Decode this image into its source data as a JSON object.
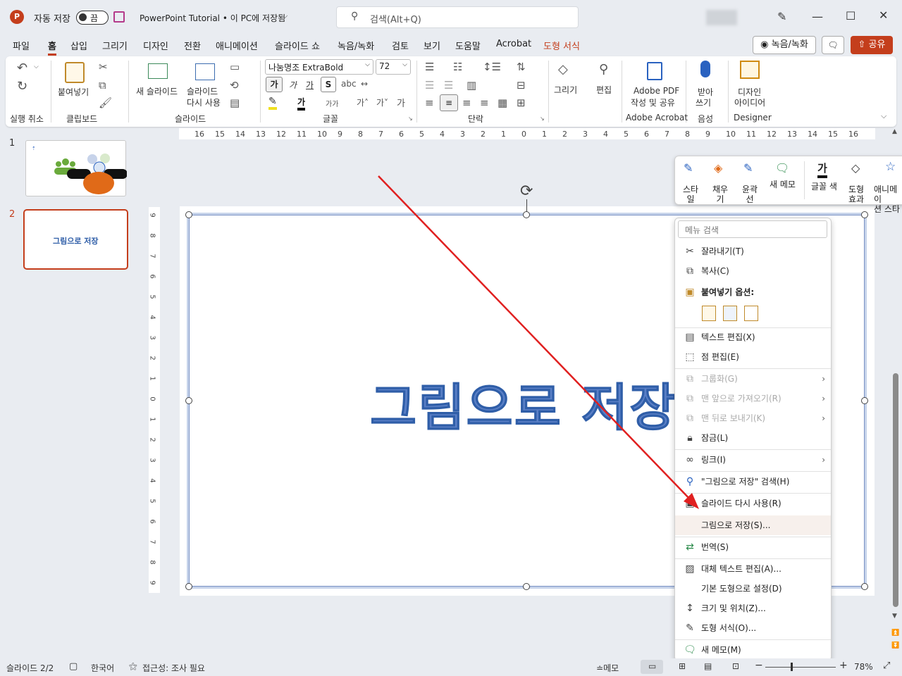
{
  "titlebar": {
    "autosave_label": "자동 저장",
    "autosave_state": "끔",
    "doc_title": "PowerPoint Tutorial • 이 PC에 저장됨",
    "search_placeholder": "검색(Alt+Q)"
  },
  "tabs": [
    "파일",
    "홈",
    "삽입",
    "그리기",
    "디자인",
    "전환",
    "애니메이션",
    "슬라이드 쇼",
    "녹음/녹화",
    "검토",
    "보기",
    "도움말",
    "Acrobat",
    "도형 서식"
  ],
  "active_tab": "홈",
  "record_button": "녹음/녹화",
  "share_button": "공유",
  "ribbon": {
    "groups": [
      "실행 취소",
      "클립보드",
      "슬라이드",
      "글꼴",
      "단락",
      "Adobe Acrobat",
      "음성",
      "Designer"
    ],
    "paste_label": "붙여넣기",
    "new_slide_label": "새 슬라이드",
    "reuse_slide_label_1": "슬라이드",
    "reuse_slide_label_2": "다시 사용",
    "font_name": "나눔명조 ExtraBold",
    "font_size": "72",
    "bold_glyph": "가",
    "drawing_label": "그리기",
    "editing_label": "편집",
    "adobe_label_1": "Adobe PDF",
    "adobe_label_2": "작성 및 공유",
    "dictate_label_1": "받아",
    "dictate_label_2": "쓰기",
    "designer_label_1": "디자인",
    "designer_label_2": "아이디어"
  },
  "ruler_h": [
    "16",
    "15",
    "14",
    "13",
    "12",
    "11",
    "10",
    "9",
    "8",
    "7",
    "6",
    "5",
    "4",
    "3",
    "2",
    "1",
    "0",
    "1",
    "2",
    "3",
    "4",
    "5",
    "6",
    "7",
    "8",
    "9",
    "10",
    "11",
    "12",
    "13",
    "14",
    "15",
    "16"
  ],
  "ruler_v": [
    "9",
    "8",
    "7",
    "6",
    "5",
    "4",
    "3",
    "2",
    "1",
    "0",
    "1",
    "2",
    "3",
    "4",
    "5",
    "6",
    "7",
    "8",
    "9"
  ],
  "slides": [
    {
      "number": "1"
    },
    {
      "number": "2",
      "title": "그림으로 저장"
    }
  ],
  "slide_text": "그림으로 저장",
  "mini_toolbar": {
    "style_1": "스타",
    "style_2": "일",
    "fill_1": "채우",
    "fill_2": "기",
    "outline_1": "윤곽",
    "outline_2": "선",
    "new_comment": "새 메모",
    "font_color": "글꼴 색",
    "shape_effect_1": "도형",
    "shape_effect_2": "효과",
    "animation_1": "애니메이",
    "animation_2": "션 스타"
  },
  "context_menu": {
    "search_placeholder": "메뉴 검색",
    "cut": "잘라내기(T)",
    "copy": "복사(C)",
    "paste_options": "붙여넣기 옵션:",
    "edit_text": "텍스트 편집(X)",
    "edit_points": "점 편집(E)",
    "group": "그룹화(G)",
    "bring_front": "맨 앞으로 가져오기(R)",
    "send_back": "맨 뒤로 보내기(K)",
    "lock": "잠금(L)",
    "link": "링크(I)",
    "search": "\"그림으로 저장\" 검색(H)",
    "reuse_slide": "슬라이드 다시 사용(R)",
    "save_as_picture": "그림으로 저장(S)...",
    "translate": "번역(S)",
    "alt_text": "대체 텍스트 편집(A)...",
    "default_shape": "기본 도형으로 설정(D)",
    "size_position": "크기 및 위치(Z)...",
    "format_shape": "도형 서식(O)...",
    "new_comment": "새 메모(M)"
  },
  "statusbar": {
    "slide_info": "슬라이드 2/2",
    "language": "한국어",
    "accessibility": "접근성: 조사 필요",
    "notes": "메모",
    "zoom": "78%"
  },
  "colors": {
    "accent": "#c43e1c",
    "arrow": "#e02020",
    "slide_text": "#5a7fc6"
  }
}
